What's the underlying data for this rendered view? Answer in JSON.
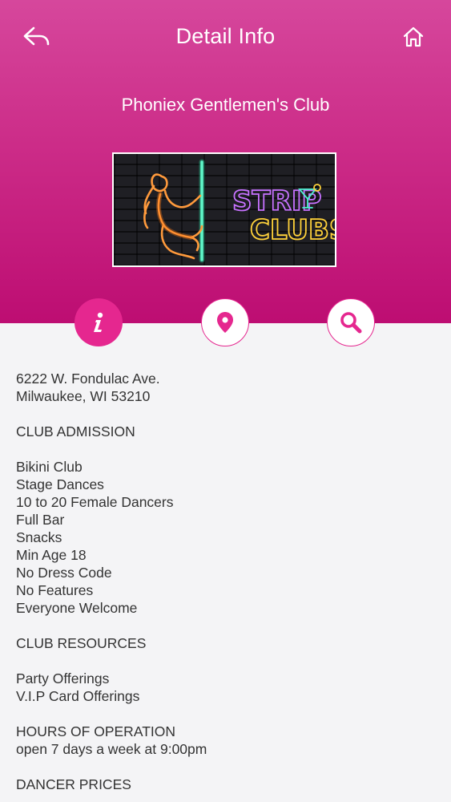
{
  "nav": {
    "title": "Detail Info",
    "back_icon": "back-arrow-icon",
    "home_icon": "home-icon"
  },
  "club": {
    "name": "Phoniex Gentlemen's Club",
    "banner": {
      "line1": "STRIP",
      "line2": "CLUBS",
      "icons": [
        "dancer-silhouette-icon",
        "pole-icon",
        "cocktail-glass-icon"
      ]
    }
  },
  "tabs": [
    {
      "icon": "info-icon",
      "active": true
    },
    {
      "icon": "map-pin-icon",
      "active": false
    },
    {
      "icon": "search-icon",
      "active": false
    }
  ],
  "details": {
    "address": [
      "6222 W. Fondulac Ave.",
      "Milwaukee, WI 53210"
    ],
    "admission_heading": "CLUB ADMISSION",
    "admission_items": [
      "Bikini Club",
      "Stage Dances",
      "10 to 20 Female Dancers",
      "Full Bar",
      "Snacks",
      "Min Age 18",
      "No Dress Code",
      "No Features",
      "Everyone Welcome"
    ],
    "resources_heading": "CLUB RESOURCES",
    "resources_items": [
      "Party Offerings",
      "V.I.P Card Offerings"
    ],
    "hours_heading": "HOURS OF OPERATION",
    "hours_text": "open 7 days a week at 9:00pm",
    "prices_heading": "DANCER PRICES"
  },
  "colors": {
    "header_top": "#d6479c",
    "header_bottom": "#bd0d72",
    "accent": "#e5278f",
    "text": "#333333",
    "background": "#f4f4f6"
  }
}
